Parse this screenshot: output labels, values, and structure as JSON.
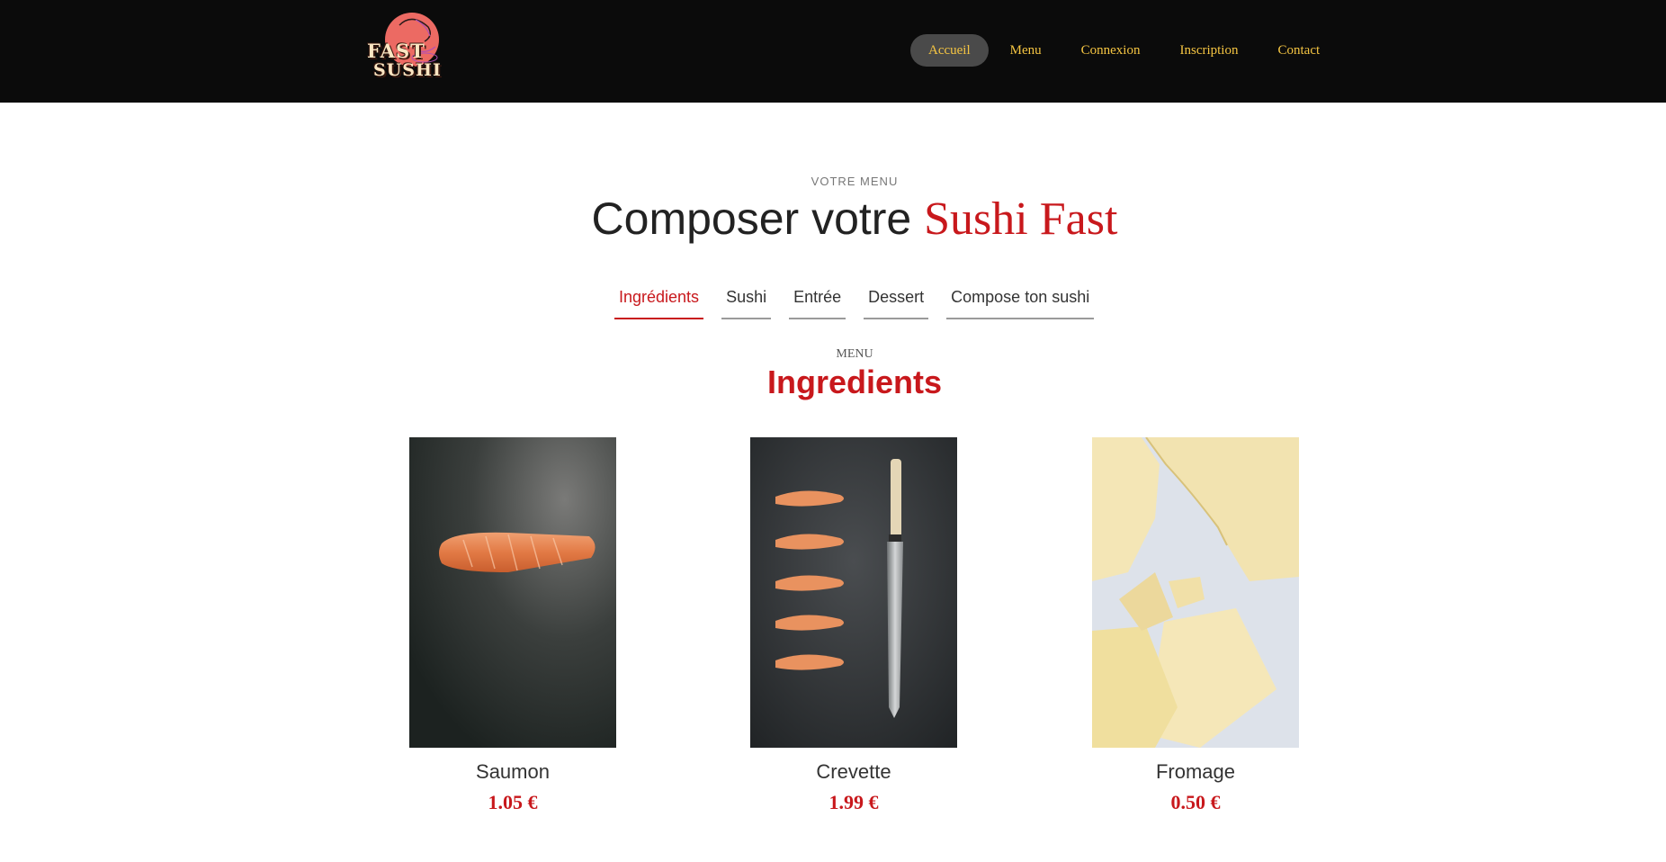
{
  "brand": {
    "logo_line1": "FAST",
    "logo_line2": "SUSHI"
  },
  "nav": {
    "items": [
      {
        "label": "Accueil",
        "active": true
      },
      {
        "label": "Menu",
        "active": false
      },
      {
        "label": "Connexion",
        "active": false
      },
      {
        "label": "Inscription",
        "active": false
      },
      {
        "label": "Contact",
        "active": false
      }
    ]
  },
  "section": {
    "eyebrow": "VOTRE MENU",
    "title_plain": "Composer votre ",
    "title_accent": "Sushi Fast"
  },
  "tabs": [
    {
      "label": "Ingrédients",
      "active": true
    },
    {
      "label": "Sushi",
      "active": false
    },
    {
      "label": "Entrée",
      "active": false
    },
    {
      "label": "Dessert",
      "active": false
    },
    {
      "label": "Compose ton sushi",
      "active": false
    }
  ],
  "menu": {
    "kicker": "MENU",
    "title": "Ingredients",
    "products": [
      {
        "name": "Saumon",
        "price": "1.05 €",
        "image": "salmon-fillet-photo"
      },
      {
        "name": "Crevette",
        "price": "1.99 €",
        "image": "shrimp-and-knife-photo"
      },
      {
        "name": "Fromage",
        "price": "0.50 €",
        "image": "cheese-slices-photo"
      }
    ]
  },
  "colors": {
    "header_bg": "#0b0b0b",
    "nav_text": "#f5c542",
    "accent_red": "#c8181c",
    "active_pill": "#4a4a4a"
  }
}
